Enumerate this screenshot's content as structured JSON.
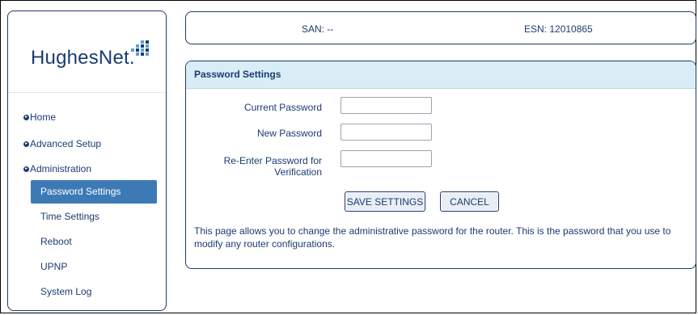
{
  "brand": {
    "logo_text": "HughesNet.",
    "logo_icon": "hughesnet-grid-logo"
  },
  "sidebar": {
    "top_items": [
      {
        "label": "Home",
        "icon": "circle-arrow-right-icon"
      },
      {
        "label": "Advanced Setup",
        "icon": "circle-arrow-right-icon"
      },
      {
        "label": "Administration",
        "icon": "circle-arrow-right-icon"
      }
    ],
    "sub_items": [
      {
        "label": "Password Settings",
        "active": true
      },
      {
        "label": "Time Settings",
        "active": false
      },
      {
        "label": "Reboot",
        "active": false
      },
      {
        "label": "UPNP",
        "active": false
      },
      {
        "label": "System Log",
        "active": false
      }
    ]
  },
  "header": {
    "san": "SAN: --",
    "esn": "ESN: 12010865"
  },
  "panel": {
    "title": "Password Settings",
    "fields": [
      {
        "label": "Current Password",
        "value": ""
      },
      {
        "label": "New Password",
        "value": ""
      },
      {
        "label": "Re-Enter Password for Verification",
        "value": ""
      }
    ],
    "save_label": "SAVE SETTINGS",
    "cancel_label": "CANCEL",
    "description": "This page allows you to change the administrative password for the router. This is the password that you use to modify any router configurations."
  },
  "colors": {
    "accent": "#3d7ab5",
    "text": "#1b3b73",
    "panel_header_bg": "#d9edf7"
  }
}
